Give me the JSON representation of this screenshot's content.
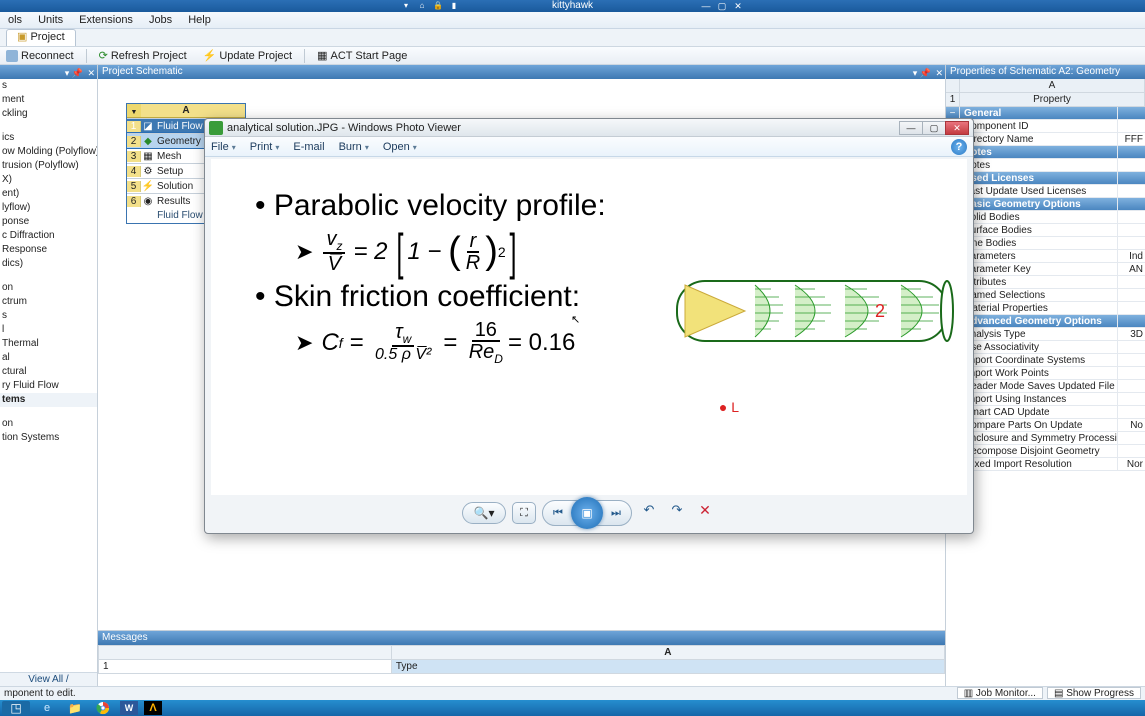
{
  "titlebar": {
    "title": "kittyhawk"
  },
  "menubar": {
    "items": [
      "ols",
      "Units",
      "Extensions",
      "Jobs",
      "Help"
    ]
  },
  "project_tab": "Project",
  "toolbar": {
    "reconnect": "Reconnect",
    "refresh": "Refresh Project",
    "update": "Update Project",
    "act": "ACT Start Page"
  },
  "toolbox": {
    "title": "",
    "items_top": [
      "s",
      "ment",
      "ckling"
    ],
    "items_mid": [
      "ics",
      "ow Molding (Polyflow)",
      "trusion (Polyflow)",
      "X)",
      "ent)",
      "lyflow)",
      "ponse",
      "c Diffraction",
      "Response",
      "dics)"
    ],
    "items_mid2": [
      "on",
      "ctrum",
      "s",
      "l",
      "Thermal",
      "al",
      "ctural",
      "ry Fluid Flow"
    ],
    "group_systems": "tems",
    "items_bot": [
      "on",
      "tion Systems"
    ],
    "view_all": "View All / Customize..."
  },
  "schematic": {
    "title": "Project Schematic",
    "system": {
      "head_col": "A",
      "title_row": "Fluid Flow (F",
      "rows": [
        {
          "n": "1",
          "label": "Fluid Flow (F"
        },
        {
          "n": "2",
          "label": "Geometry"
        },
        {
          "n": "3",
          "label": "Mesh"
        },
        {
          "n": "4",
          "label": "Setup"
        },
        {
          "n": "5",
          "label": "Solution"
        },
        {
          "n": "6",
          "label": "Results"
        }
      ],
      "caption": "Fluid Flow (F"
    }
  },
  "messages": {
    "title": "Messages",
    "col_a": "A",
    "row1_num": "1",
    "row1_val": "Type"
  },
  "props": {
    "title": "Properties of Schematic A2: Geometry",
    "col_a": "A",
    "col_b": "Property",
    "sections": [
      {
        "kind": "section",
        "label": "General"
      },
      {
        "kind": "row",
        "label": "Component ID",
        "val": ""
      },
      {
        "kind": "row",
        "label": "Directory Name",
        "val": "FFF"
      },
      {
        "kind": "section",
        "label": "Notes"
      },
      {
        "kind": "row",
        "label": "Notes",
        "val": ""
      },
      {
        "kind": "section",
        "label": "Used Licenses"
      },
      {
        "kind": "row",
        "label": "Last Update Used Licenses",
        "val": ""
      },
      {
        "kind": "section",
        "label": "Basic Geometry Options"
      },
      {
        "kind": "row",
        "label": "Solid Bodies",
        "val": ""
      },
      {
        "kind": "row",
        "label": "Surface Bodies",
        "val": ""
      },
      {
        "kind": "row",
        "label": "Line Bodies",
        "val": ""
      },
      {
        "kind": "row",
        "label": "Parameters",
        "val": "Ind"
      },
      {
        "kind": "row",
        "label": "Parameter Key",
        "val": "AN"
      },
      {
        "kind": "row",
        "label": "Attributes",
        "val": ""
      },
      {
        "kind": "row",
        "label": "Named Selections",
        "val": ""
      },
      {
        "kind": "row",
        "label": "Material Properties",
        "val": ""
      },
      {
        "kind": "section",
        "label": "Advanced Geometry Options"
      },
      {
        "kind": "row",
        "label": "Analysis Type",
        "val": "3D"
      },
      {
        "kind": "row",
        "label": "Use Associativity",
        "val": ""
      },
      {
        "kind": "row",
        "label": "Import Coordinate Systems",
        "val": ""
      },
      {
        "kind": "row",
        "label": "Import Work Points",
        "val": ""
      },
      {
        "kind": "row",
        "label": "Reader Mode Saves Updated File",
        "val": ""
      },
      {
        "kind": "row",
        "label": "Import Using Instances",
        "val": ""
      },
      {
        "kind": "row",
        "label": "Smart CAD Update",
        "val": ""
      },
      {
        "kind": "row",
        "label": "Compare Parts On Update",
        "val": "No"
      },
      {
        "kind": "row",
        "label": "Enclosure and Symmetry Processing",
        "val": ""
      },
      {
        "kind": "row",
        "label": "Decompose Disjoint Geometry",
        "val": ""
      },
      {
        "kind": "row",
        "label": "Mixed Import Resolution",
        "val": "Nor"
      }
    ]
  },
  "statusbar": {
    "hint": "mponent to edit.",
    "job_monitor": "Job Monitor...",
    "show_progress": "Show Progress"
  },
  "photoviewer": {
    "title": "analytical solution.JPG - Windows Photo Viewer",
    "menus": {
      "file": "File",
      "print": "Print",
      "email": "E-mail",
      "burn": "Burn",
      "open": "Open"
    }
  },
  "slide": {
    "bullet1": "Parabolic velocity profile:",
    "eq1_lhs_num": "v",
    "eq1_lhs_num_sub": "z",
    "eq1_lhs_den": "V̅",
    "eq1_eq": "= 2",
    "eq1_rR_num": "r",
    "eq1_rR_den": "R",
    "eq1_exp": "2",
    "bullet2": "Skin friction coefficient:",
    "eq2_Cf": "C",
    "eq2_Cf_sub": "f",
    "eq2_tau_num": "τ",
    "eq2_tau_num_sub": "w",
    "eq2_tau_den": "0.5 ρ V̅²",
    "eq2_mid_num": "16",
    "eq2_mid_den": "Re",
    "eq2_mid_den_sub": "D",
    "eq2_result": "= 0.16",
    "pipe_label": "2",
    "red_annot": "L"
  }
}
